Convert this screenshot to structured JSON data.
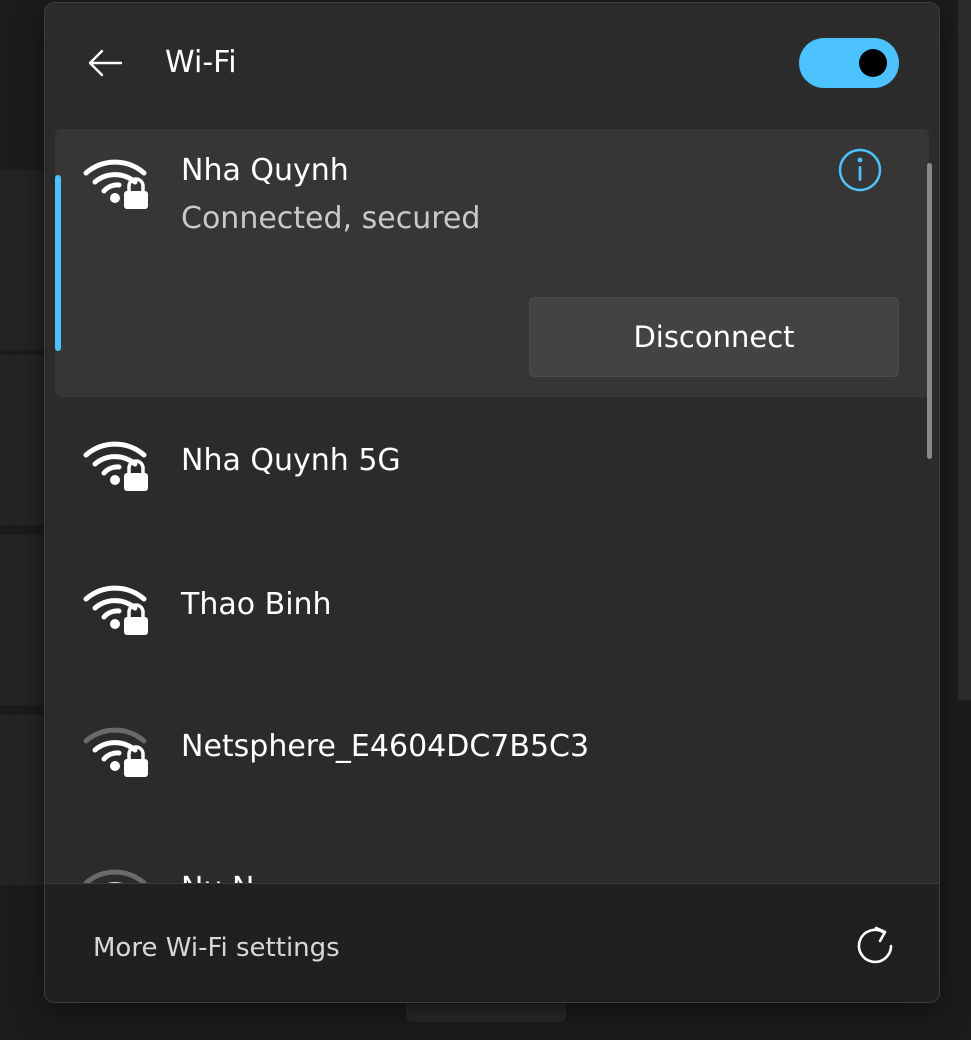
{
  "header": {
    "title": "Wi-Fi",
    "back_icon": "back-arrow-icon",
    "toggle_state": "on",
    "accent_color": "#4cc2ff"
  },
  "networks": [
    {
      "name": "Nha Quynh",
      "status": "Connected, secured",
      "connected": true,
      "secured": true,
      "signal": "full",
      "action_label": "Disconnect"
    },
    {
      "name": "Nha Quynh 5G",
      "secured": true,
      "signal": "full"
    },
    {
      "name": "Thao Binh",
      "secured": true,
      "signal": "full"
    },
    {
      "name": "Netsphere_E4604DC7B5C3",
      "secured": true,
      "signal": "partial"
    },
    {
      "name": "Nu N",
      "secured": true,
      "signal": "partial"
    }
  ],
  "footer": {
    "more_settings_label": "More Wi-Fi settings",
    "refresh_icon": "refresh-icon"
  }
}
